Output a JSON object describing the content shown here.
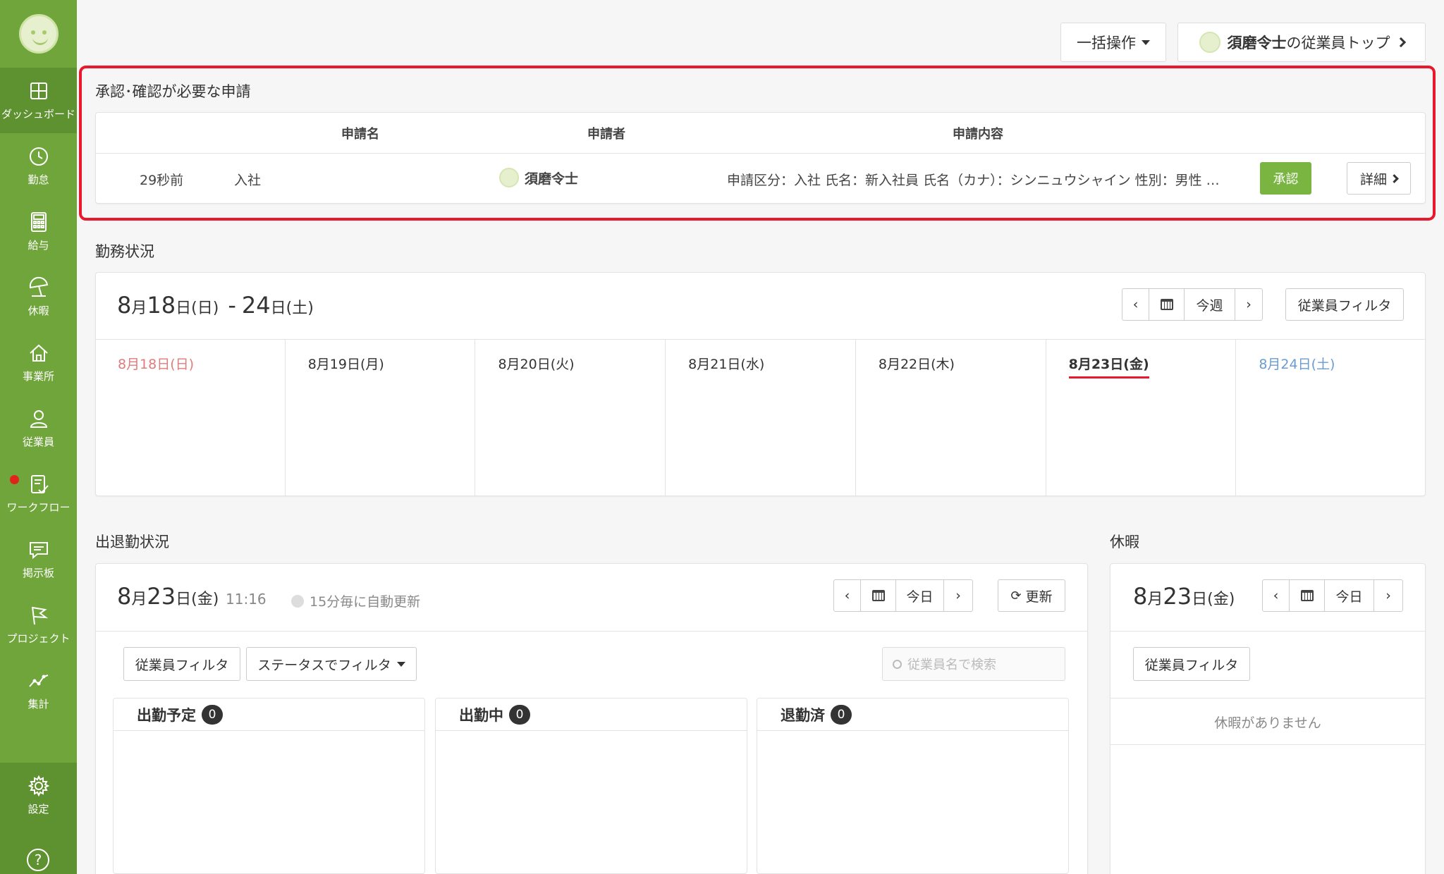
{
  "sidebar": {
    "items": [
      {
        "label": "ダッシュボード",
        "icon": "dashboard-icon",
        "active": true
      },
      {
        "label": "勤怠",
        "icon": "clock-icon"
      },
      {
        "label": "給与",
        "icon": "calculator-icon"
      },
      {
        "label": "休暇",
        "icon": "beach-umbrella-icon"
      },
      {
        "label": "事業所",
        "icon": "home-icon"
      },
      {
        "label": "従業員",
        "icon": "person-icon"
      },
      {
        "label": "ワークフロー",
        "icon": "clipboard-check-icon",
        "notification_dot": true
      },
      {
        "label": "掲示板",
        "icon": "speech-bubble-icon"
      },
      {
        "label": "プロジェクト",
        "icon": "flag-icon"
      },
      {
        "label": "集計",
        "icon": "line-chart-icon"
      }
    ],
    "settings_label": "設定"
  },
  "header": {
    "bulk_label": "一括操作",
    "employee_top_name": "須磨令士",
    "employee_top_suffix": "の従業員トップ"
  },
  "approvals": {
    "title": "承認･確認が必要な申請",
    "columns": {
      "name": "申請名",
      "applicant": "申請者",
      "content": "申請内容"
    },
    "rows": [
      {
        "time": "29秒前",
        "name": "入社",
        "applicant": "須磨令士",
        "content": "申請区分：入社 氏名：新入社員 氏名（カナ）：シンニュウシャイン 性別：男性 …",
        "approve_label": "承認",
        "detail_label": "詳細"
      }
    ]
  },
  "work_status": {
    "title": "勤務状況",
    "range": {
      "m1": "8",
      "d1": "18",
      "w1": "(日)",
      "d2": "24",
      "w2": "(土)",
      "dash": "-",
      "month_char": "月",
      "day_char": "日"
    },
    "this_week_label": "今週",
    "filter_label": "従業員フィルタ",
    "days": [
      "8月18日(日)",
      "8月19日(月)",
      "8月20日(火)",
      "8月21日(水)",
      "8月22日(木)",
      "8月23日(金)",
      "8月24日(土)"
    ]
  },
  "attendance": {
    "title": "出退勤状況",
    "date": {
      "m": "8",
      "d": "23",
      "w": "(金)",
      "month_char": "月",
      "day_char": "日"
    },
    "time": "11:16",
    "auto_refresh": "15分毎に自動更新",
    "today_label": "今日",
    "refresh_label": "更新",
    "filter_employee": "従業員フィルタ",
    "filter_status": "ステータスでフィルタ",
    "search_placeholder": "従業員名で検索",
    "columns": [
      {
        "label": "出勤予定",
        "count": "0"
      },
      {
        "label": "出勤中",
        "count": "0"
      },
      {
        "label": "退勤済",
        "count": "0"
      }
    ]
  },
  "leave": {
    "title": "休暇",
    "date": {
      "m": "8",
      "d": "23",
      "w": "(金)",
      "month_char": "月",
      "day_char": "日"
    },
    "today_label": "今日",
    "filter_label": "従業員フィルタ",
    "empty": "休暇がありません"
  }
}
